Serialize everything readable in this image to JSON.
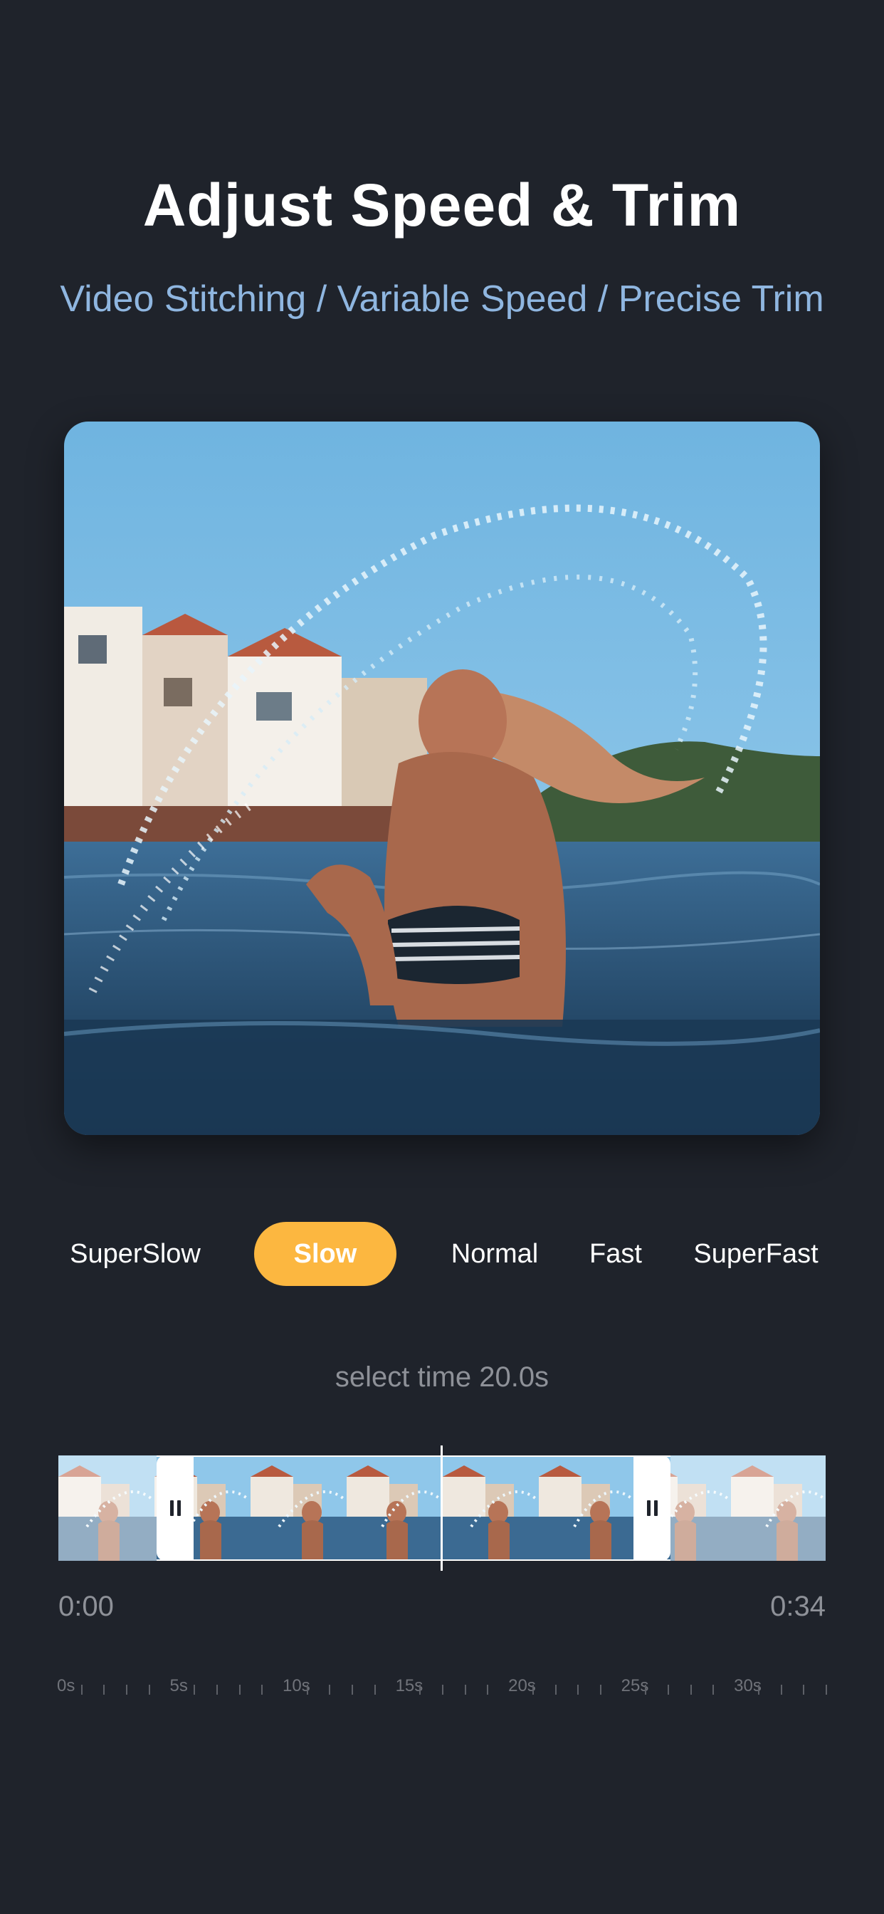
{
  "title": "Adjust Speed & Trim",
  "subtitle": "Video Stitching / Variable Speed / Precise Trim",
  "speeds": [
    {
      "label": "SuperSlow",
      "active": false
    },
    {
      "label": "Slow",
      "active": true
    },
    {
      "label": "Normal",
      "active": false
    },
    {
      "label": "Fast",
      "active": false
    },
    {
      "label": "SuperFast",
      "active": false
    }
  ],
  "select_time": "select time 20.0s",
  "time_start": "0:00",
  "time_end": "0:34",
  "ruler_labels": [
    "0s",
    "5s",
    "10s",
    "15s",
    "20s",
    "25s",
    "30s"
  ],
  "colors": {
    "background": "#1f232b",
    "accent": "#fcb740",
    "subtitle": "#8fb6e0"
  }
}
